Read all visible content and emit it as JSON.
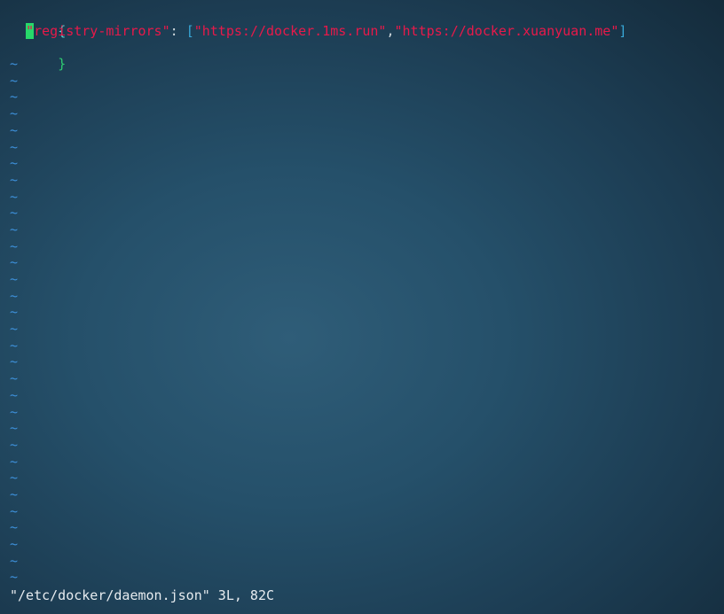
{
  "editor": {
    "lines": [
      {
        "open_brace": "{"
      },
      {
        "indent": "  ",
        "key_quote": "\"",
        "key_text": "registry-mirrors",
        "key_close_quote": "\"",
        "colon": ": ",
        "open_bracket": "[",
        "mirror_1": "\"https://docker.1ms.run\"",
        "comma": ",",
        "mirror_2": "\"https://docker.xuanyuan.me\"",
        "close_bracket": "]"
      },
      {
        "close_brace": "}"
      }
    ],
    "empty_line_marker": "~",
    "empty_line_count": 32
  },
  "status_bar": {
    "message": "\"/etc/docker/daemon.json\" 3L, 82C"
  },
  "colors": {
    "background": "#25506a",
    "string": "#e8194a",
    "cursor": "#27d96a",
    "tilde": "#3d8fd8",
    "bracket": "#38a8d8",
    "status_text": "#e6ebef"
  }
}
